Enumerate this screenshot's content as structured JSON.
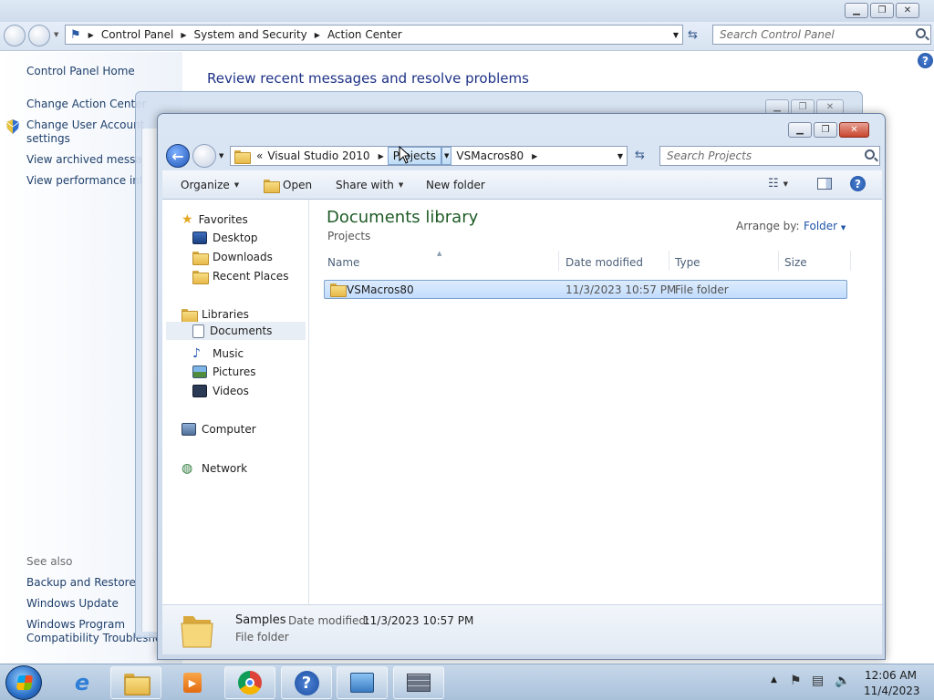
{
  "control_panel": {
    "breadcrumb": [
      "Control Panel",
      "System and Security",
      "Action Center"
    ],
    "search_placeholder": "Search Control Panel",
    "left_links": [
      "Control Panel Home",
      "Change Action Center",
      "Change User Account",
      "settings",
      "View archived messages",
      "View performance info"
    ],
    "see_also_label": "See also",
    "see_also_links": [
      "Backup and Restore",
      "Windows Update",
      "Windows Program",
      "Compatibility Troubleshooter"
    ],
    "heading": "Review recent messages and resolve problems"
  },
  "explorer": {
    "breadcrumb": {
      "overflow": "«",
      "segments": [
        "Visual Studio 2010",
        "Projects",
        "VSMacros80"
      ]
    },
    "search_placeholder": "Search Projects",
    "toolbar": {
      "organize": "Organize",
      "open": "Open",
      "share_with": "Share with",
      "new_folder": "New folder"
    },
    "nav": {
      "favorites": "Favorites",
      "desktop": "Desktop",
      "downloads": "Downloads",
      "recent_places": "Recent Places",
      "libraries": "Libraries",
      "documents": "Documents",
      "music": "Music",
      "pictures": "Pictures",
      "videos": "Videos",
      "computer": "Computer",
      "network": "Network"
    },
    "library_title": "Documents library",
    "library_subtitle": "Projects",
    "arrange_by_label": "Arrange by:",
    "arrange_by_value": "Folder",
    "columns": [
      "Name",
      "Date modified",
      "Type",
      "Size"
    ],
    "rows": [
      {
        "name": "VSMacros80",
        "date": "11/3/2023 10:57 PM",
        "type": "File folder",
        "size": ""
      }
    ],
    "details": {
      "name": "Samples",
      "date_label": "Date modified:",
      "date_value": "11/3/2023 10:57 PM",
      "type": "File folder"
    }
  },
  "taskbar": {
    "time": "12:06 AM",
    "date": "11/4/2023"
  }
}
